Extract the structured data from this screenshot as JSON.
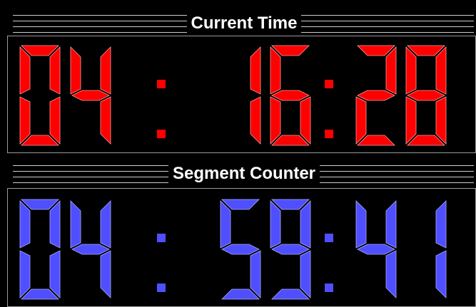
{
  "current_time": {
    "title": "Current Time",
    "value": "04:16:28",
    "color": "#ff0000",
    "edge_color": "#ff9a9a"
  },
  "segment_counter": {
    "title": "Segment Counter",
    "value": "04:59:41",
    "color": "#4f4fff",
    "edge_color": "#a9a9ff"
  },
  "colors": {
    "background": "#000000",
    "rule": "#cfcfcf",
    "frame": "#9a9a9a",
    "title": "#ffffff"
  }
}
